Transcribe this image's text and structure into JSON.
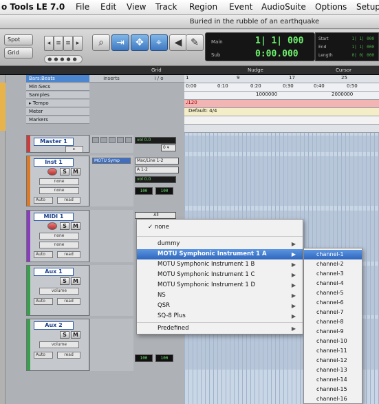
{
  "menubar": {
    "app": "o Tools LE 7.0",
    "items": [
      "File",
      "Edit",
      "View",
      "Track",
      "Region",
      "Event",
      "AudioSuite",
      "Options",
      "Setup"
    ]
  },
  "window": {
    "title": "Buried in the rubble of an earthquake"
  },
  "toolbar": {
    "modes": [
      "Spot",
      "Grid"
    ],
    "counter": {
      "main_label": "Main",
      "main_value": "1| 1| 000",
      "sub_label": "Sub",
      "sub_value": "0:00.000"
    },
    "selection": {
      "labels": [
        "Start",
        "End",
        "Length"
      ],
      "values": [
        "1| 1| 000",
        "1| 1| 000",
        "0| 0| 000"
      ]
    }
  },
  "edit_strip": {
    "grid_label": "Grid",
    "nudge_label": "Nudge",
    "cursor_label": "Cursor"
  },
  "rulers": {
    "labels": [
      "Bars:Beats",
      "Min:Secs",
      "Samples",
      "Tempo",
      "Meter",
      "Markers"
    ],
    "bars": [
      "1",
      "9",
      "17",
      "25"
    ],
    "minsecs": [
      "0:00",
      "0:10",
      "0:20",
      "0:30",
      "0:40",
      "0:50"
    ],
    "samples": [
      "1000000",
      "2000000"
    ],
    "tempo_value": "♩120",
    "meter_value": "Default: 4/4"
  },
  "columns": {
    "inserts": "inserts",
    "io": "i / o"
  },
  "tracks": [
    {
      "name": "Master 1",
      "color": "#d23a3a",
      "volume": "0.0"
    },
    {
      "name": "Inst 1",
      "color": "#e07a22",
      "insert": "MOTU Symp",
      "io_in": "Mac/Line 1-2",
      "io_out": "A 1-2",
      "volume": "0.0",
      "voice": "none",
      "pan_l": "100",
      "pan_r": "100"
    },
    {
      "name": "MIDI 1",
      "color": "#8a3bbf",
      "voice": "none",
      "io_all": "All"
    },
    {
      "name": "Aux 1",
      "color": "#35a24a",
      "vol_label": "volume"
    },
    {
      "name": "Aux 2",
      "color": "#35a24a",
      "vol_label": "volume",
      "pan_l": "100",
      "pan_r": "100"
    }
  ],
  "track_buttons": {
    "solo": "S",
    "mute": "M",
    "auto": "Auto",
    "read": "read",
    "voice_label": "none",
    "vol_label": "volume"
  },
  "menu": {
    "checked": "none",
    "items": [
      {
        "label": "dummy",
        "submenu": true
      },
      {
        "label": "MOTU Symphonic Instrument 1 A",
        "submenu": true,
        "highlighted": true
      },
      {
        "label": "MOTU Symphonic Instrument 1 B",
        "submenu": true
      },
      {
        "label": "MOTU Symphonic Instrument 1 C",
        "submenu": true
      },
      {
        "label": "MOTU Symphonic Instrument 1 D",
        "submenu": true
      },
      {
        "label": "NS",
        "submenu": true
      },
      {
        "label": "QSR",
        "submenu": true
      },
      {
        "label": "SQ-8 Plus",
        "submenu": true
      }
    ],
    "predefined": "Predefined"
  },
  "submenu": {
    "channels": [
      "channel-1",
      "channel-2",
      "channel-3",
      "channel-4",
      "channel-5",
      "channel-6",
      "channel-7",
      "channel-8",
      "channel-9",
      "channel-10",
      "channel-11",
      "channel-12",
      "channel-13",
      "channel-14",
      "channel-15",
      "channel-16"
    ]
  }
}
